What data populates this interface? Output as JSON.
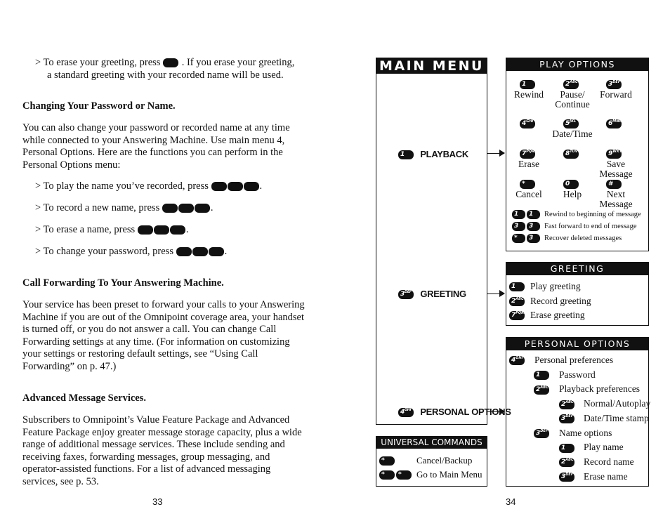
{
  "left": {
    "erase_greeting": {
      "a": "> To erase your greeting, press",
      "b": ". If you erase your greeting,",
      "c": "a standard greeting with your recorded name will be used."
    },
    "h1": "Changing Your Password or Name.",
    "p1": [
      "You can also change your password or recorded name at any time",
      "while connected to your Answering Machine.  Use main menu 4,",
      "Personal Options.  Here are the functions you can perform in the",
      "Personal Options menu:"
    ],
    "bullets": [
      "> To play the name you’ve recorded, press",
      "> To record a new name, press",
      "> To erase a name, press",
      "> To change your password, press"
    ],
    "h2": "Call Forwarding To Your Answering Machine.",
    "p2": [
      "Your service has been preset to forward your calls to your Answering",
      "Machine if you are out of the Omnipoint coverage area, your handset",
      "is turned off, or you do not answer a call.  You can change Call",
      "Forwarding settings at any time.  (For information on customizing",
      "your settings or restoring default settings, see “Using Call",
      "Forwarding” on p. 47.)"
    ],
    "h3": "Advanced Message Services.",
    "p3": [
      "Subscribers to Omnipoint’s Value Feature Package and Advanced",
      "Feature Package enjoy greater message storage capacity, plus a wide",
      "range of additional message services.  These include sending and",
      "receiving faxes, forwarding messages, group messaging, and",
      "operator-assisted functions.  For a list of advanced messaging",
      "services, see p. 53."
    ],
    "page": "33"
  },
  "main_menu": {
    "title": "MAIN MENU",
    "items": [
      {
        "key": "1",
        "sub": "",
        "label": "PLAYBACK"
      },
      {
        "key": "3",
        "sub": "DEF",
        "label": "GREETING"
      },
      {
        "key": "4",
        "sub": "GHI",
        "label": "PERSONAL OPTIONS"
      }
    ]
  },
  "universal": {
    "title": "UNIVERSAL COMMANDS",
    "items": [
      {
        "keys": [
          "*"
        ],
        "label": "Cancel/Backup"
      },
      {
        "keys": [
          "*",
          "*"
        ],
        "label": "Go to Main Menu"
      }
    ]
  },
  "play_options": {
    "title": "PLAY OPTIONS",
    "grid": [
      {
        "key": "1",
        "sub": "",
        "label": "Rewind"
      },
      {
        "key": "2",
        "sub": "ABC",
        "label": "Pause/ Continue"
      },
      {
        "key": "3",
        "sub": "DEF",
        "label": "Forward"
      },
      {
        "key": "4",
        "sub": "GHI",
        "label": ""
      },
      {
        "key": "5",
        "sub": "JKL",
        "label": "Date/Time"
      },
      {
        "key": "6",
        "sub": "MNO",
        "label": ""
      },
      {
        "key": "7",
        "sub": "PQRS",
        "label": "Erase"
      },
      {
        "key": "8",
        "sub": "TUV",
        "label": ""
      },
      {
        "key": "9",
        "sub": "WXYZ",
        "label": "Save Message"
      },
      {
        "key": "*",
        "sub": "",
        "label": "Cancel"
      },
      {
        "key": "0",
        "sub": "",
        "label": "Help"
      },
      {
        "key": "#",
        "sub": "",
        "label": "Next Message"
      }
    ],
    "combos": [
      {
        "keys": [
          "1",
          "1"
        ],
        "label": "Rewind to beginning of message"
      },
      {
        "keys": [
          "3",
          "3"
        ],
        "label": "Fast forward to end of message"
      },
      {
        "keys": [
          "*",
          "3"
        ],
        "label": "Recover deleted messages"
      }
    ]
  },
  "greeting": {
    "title": "GREETING",
    "items": [
      {
        "key": "1",
        "sub": "",
        "label": "Play greeting"
      },
      {
        "key": "2",
        "sub": "ABC",
        "label": "Record greeting"
      },
      {
        "key": "7",
        "sub": "PQRS",
        "label": "Erase greeting"
      }
    ]
  },
  "personal": {
    "title": "PERSONAL OPTIONS",
    "items": [
      {
        "key": "4",
        "sub": "GHI",
        "label": "Personal preferences",
        "level": 0
      },
      {
        "key": "1",
        "sub": "",
        "label": "Password",
        "level": 1
      },
      {
        "key": "2",
        "sub": "ABC",
        "label": "Playback preferences",
        "level": 1
      },
      {
        "key": "2",
        "sub": "ABC",
        "label": "Normal/Autoplay",
        "level": 2
      },
      {
        "key": "3",
        "sub": "DEF",
        "label": "Date/Time stamp",
        "level": 2
      },
      {
        "key": "3",
        "sub": "DEF",
        "label": "Name options",
        "level": 1
      },
      {
        "key": "1",
        "sub": "",
        "label": "Play name",
        "level": 2
      },
      {
        "key": "2",
        "sub": "ABC",
        "label": "Record name",
        "level": 2
      },
      {
        "key": "3",
        "sub": "DEF",
        "label": "Erase name",
        "level": 2
      }
    ]
  },
  "right_page": "34"
}
